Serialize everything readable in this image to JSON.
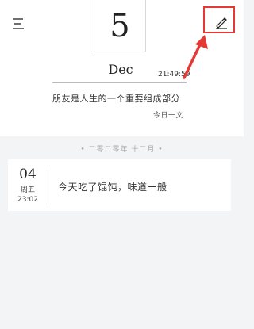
{
  "header": {
    "day": "5",
    "month": "Dec",
    "time": "21:49:59"
  },
  "quote": {
    "text": "朋友是人生的一个重要组成部分",
    "source": "今日一文"
  },
  "section": {
    "label": "• 二零二零年 十二月 •"
  },
  "entries": [
    {
      "day": "04",
      "weekday": "周五",
      "time": "23:02",
      "text": "今天吃了馄饨，味道一般"
    }
  ],
  "icons": {
    "menu": "menu-icon",
    "edit": "pencil-icon"
  },
  "colors": {
    "highlight": "#e53935",
    "background": "#f3f4f6"
  }
}
